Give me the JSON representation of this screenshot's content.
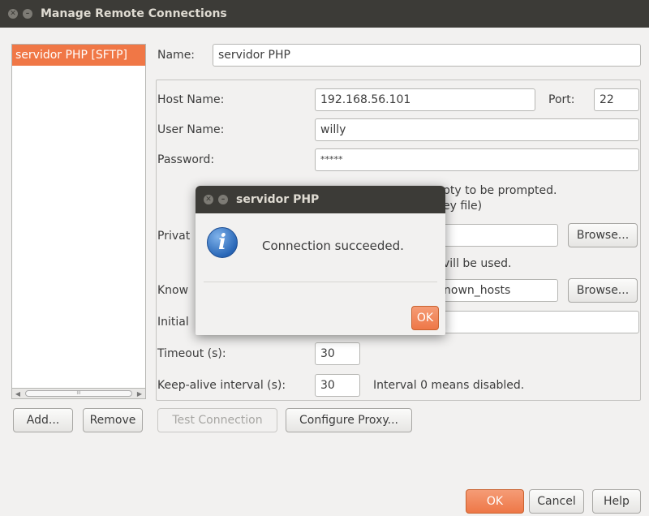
{
  "window": {
    "title": "Manage Remote Connections"
  },
  "connections": {
    "items": [
      "servidor PHP [SFTP]"
    ],
    "scroll_thumb": "III",
    "scroll_left": "◀",
    "scroll_right": "▶"
  },
  "form": {
    "name_label": "Name:",
    "name_value": "servidor PHP",
    "host_label": "Host Name:",
    "host_value": "192.168.56.101",
    "port_label": "Port:",
    "port_value": "22",
    "user_label": "User Name:",
    "user_value": "willy",
    "password_label": "Password:",
    "password_value": "*****",
    "password_hint_line1": "pty to be prompted.",
    "password_hint_line2": "ey file)",
    "private_key_label": "Privat",
    "private_key_browse": "Browse...",
    "private_key_hint": "vill be used.",
    "known_hosts_label": "Know",
    "known_hosts_value": "nown_hosts",
    "known_hosts_browse": "Browse...",
    "initial_label": "Initial",
    "timeout_label": "Timeout (s):",
    "timeout_value": "30",
    "keepalive_label": "Keep-alive interval (s):",
    "keepalive_value": "30",
    "keepalive_hint": "Interval 0 means disabled."
  },
  "list_buttons": {
    "add": "Add...",
    "remove": "Remove"
  },
  "actions": {
    "test_connection": "Test Connection",
    "configure_proxy": "Configure Proxy..."
  },
  "footer": {
    "ok": "OK",
    "cancel": "Cancel",
    "help": "Help"
  },
  "dialog": {
    "title": "servidor PHP",
    "message": "Connection succeeded.",
    "ok": "OK",
    "icon": "info-icon"
  },
  "colors": {
    "accent": "#f07746",
    "titlebar": "#3c3b37",
    "background": "#f2f1f0"
  }
}
